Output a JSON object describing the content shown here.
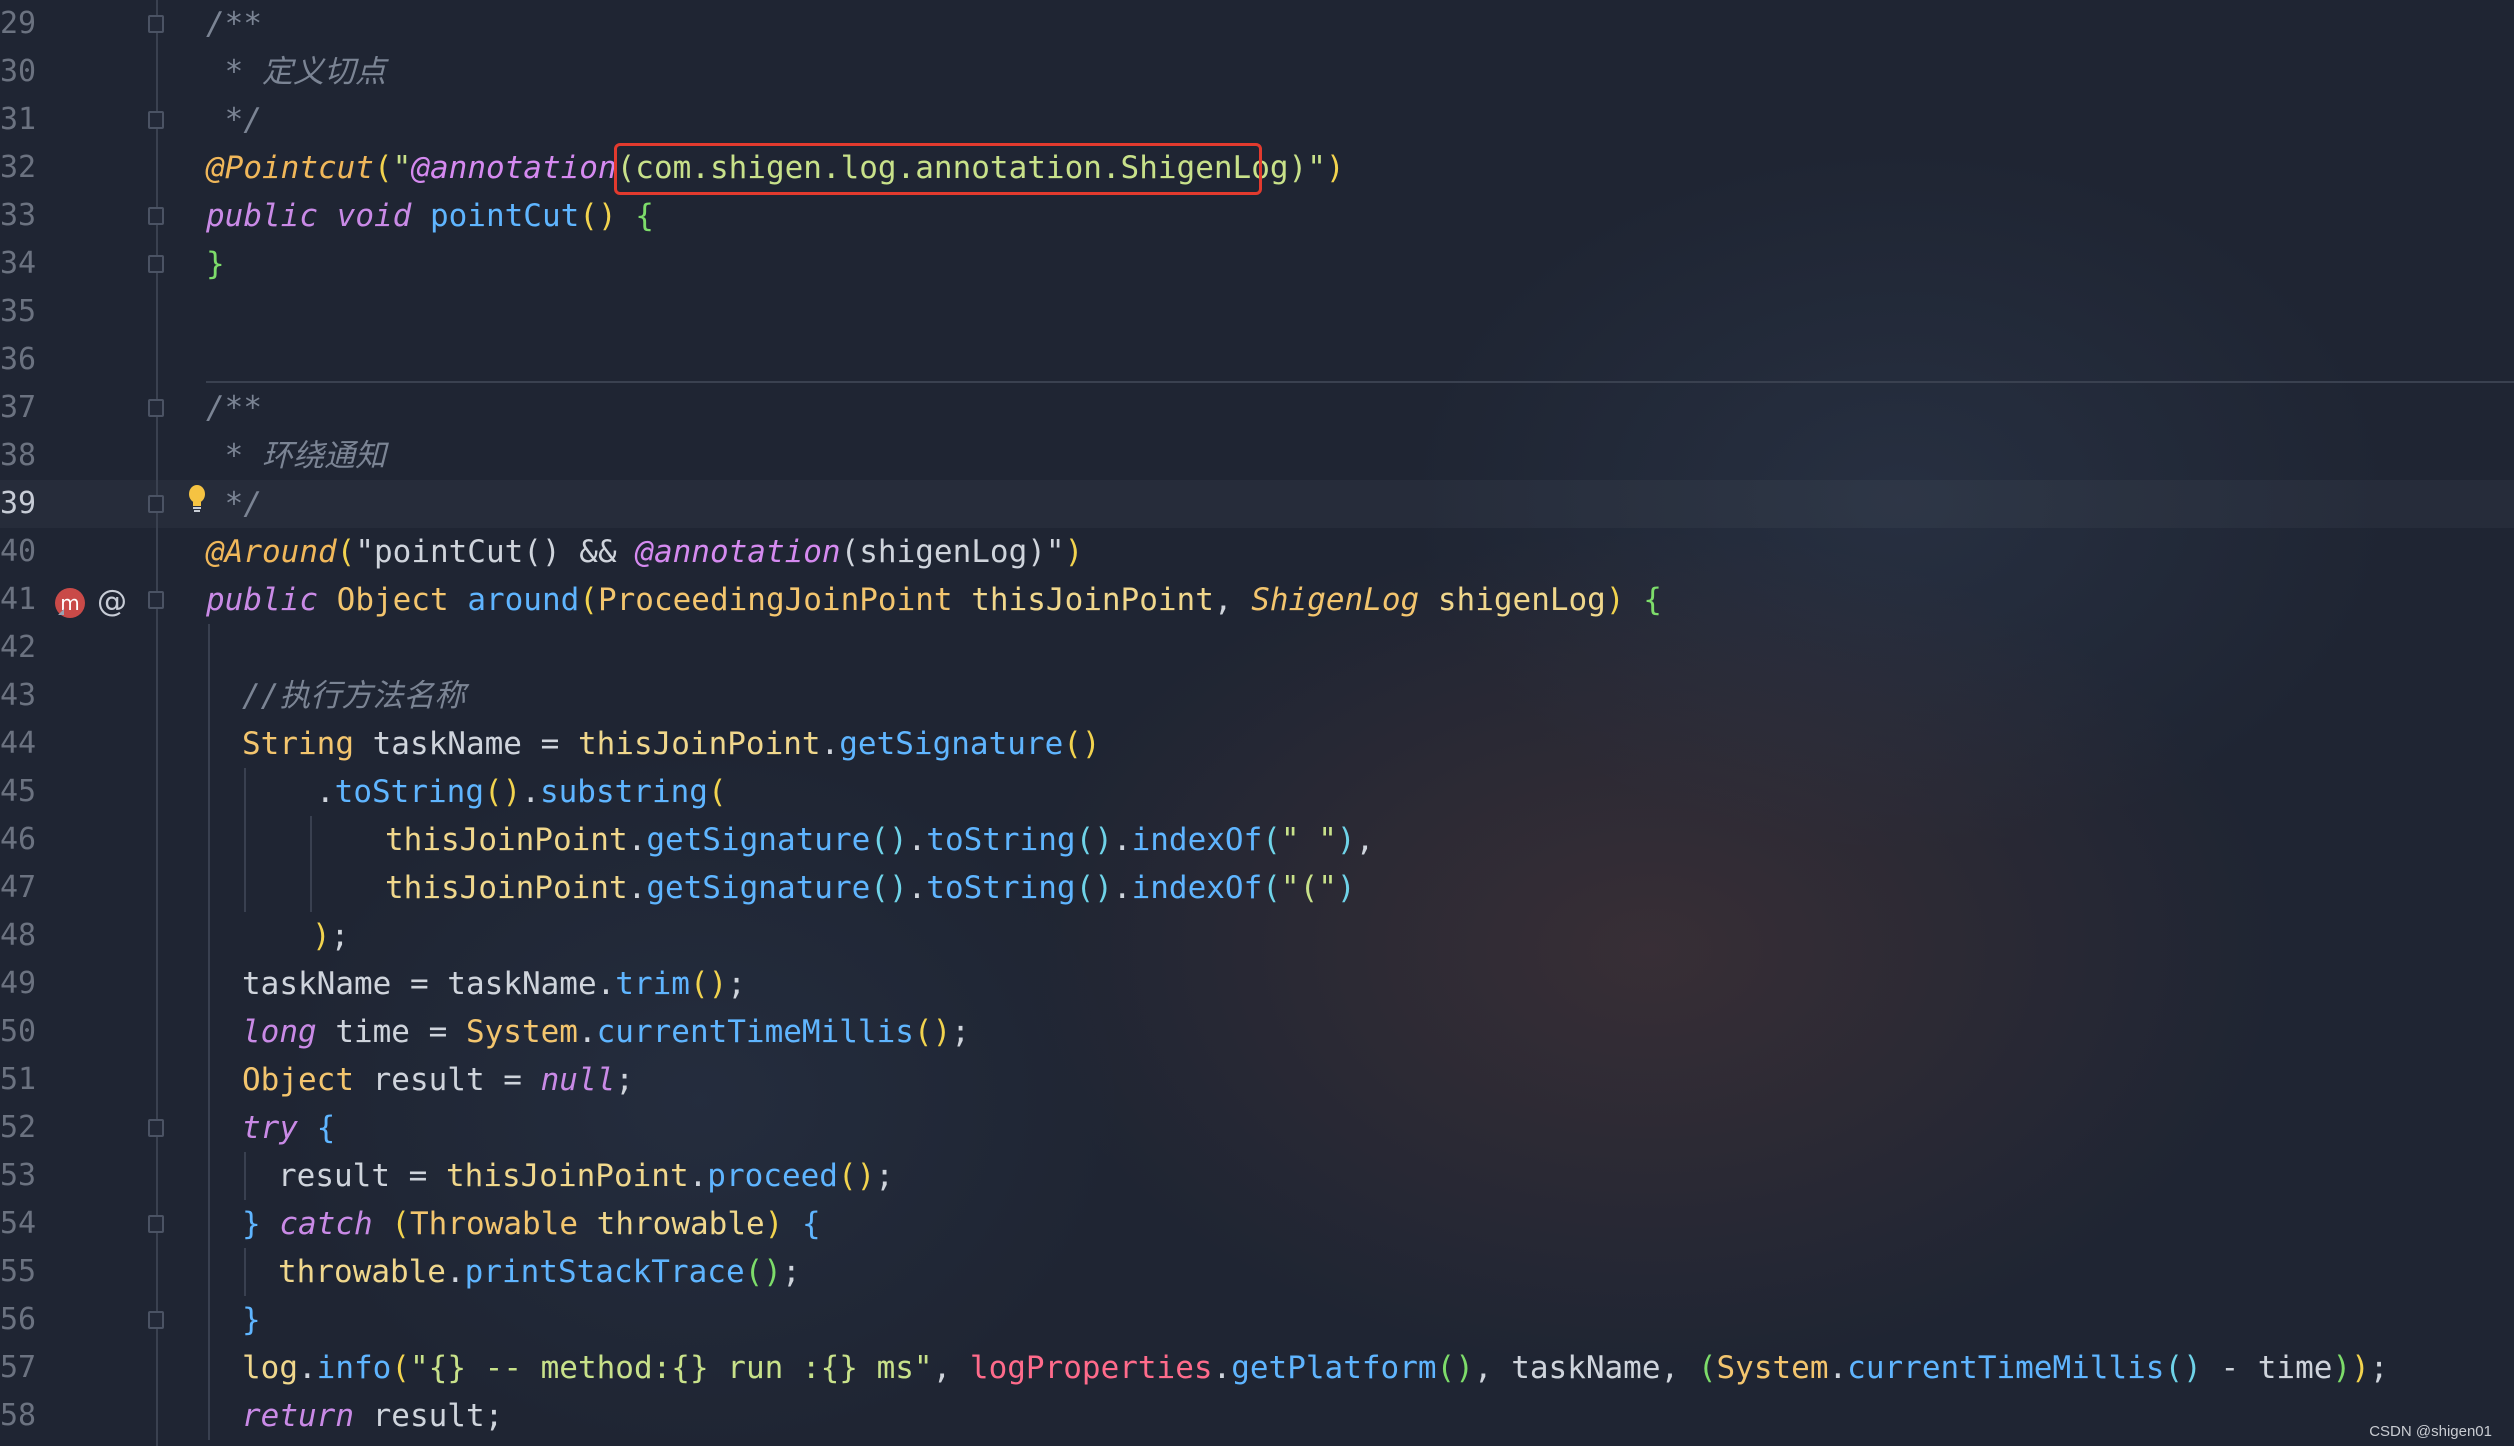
{
  "editor": {
    "current_line": "39",
    "line_numbers": [
      "29",
      "30",
      "31",
      "32",
      "33",
      "34",
      "35",
      "36",
      "37",
      "38",
      "39",
      "40",
      "41",
      "42",
      "43",
      "44",
      "45",
      "46",
      "47",
      "48",
      "49",
      "50",
      "51",
      "52",
      "53",
      "54",
      "55",
      "56",
      "57",
      "58"
    ],
    "code": {
      "l29_c": "/**",
      "l30_c": " * 定义切点",
      "l31_c": " */",
      "l32_ann": "@Pointcut",
      "l32_p1": "(",
      "l32_s1": "\"",
      "l32_s2": "@annotation",
      "l32_s3": "(com.shigen.log.annotation.ShigenLog)\"",
      "l32_p2": ")",
      "l33_k1": "public",
      "l33_k2": "void",
      "l33_m": "pointCut",
      "l33_p": "()",
      "l33_b": "{",
      "l34_b": "}",
      "l37_c": "/**",
      "l38_c": " * 环绕通知",
      "l39_c": " */",
      "l40_ann": "@Around",
      "l40_p1": "(",
      "l40_s1": "\"pointCut() && ",
      "l40_s2": "@annotation",
      "l40_s3": "(shigenLog)\"",
      "l40_p2": ")",
      "l41_k": "public",
      "l41_t": "Object",
      "l41_m": "around",
      "l41_p1": "(",
      "l41_t2": "ProceedingJoinPoint",
      "l41_v1": "thisJoinPoint",
      "l41_sep": ", ",
      "l41_t3": "ShigenLog",
      "l41_v2": "shigenLog",
      "l41_p2": ")",
      "l41_b": "{",
      "l43_c": "//执行方法名称",
      "l44_t": "String",
      "l44_a": " taskName = ",
      "l44_v": "thisJoinPoint",
      "l44_d": ".",
      "l44_m": "getSignature",
      "l44_p": "()",
      "l45_d": ".",
      "l45_m1": "toString",
      "l45_p1": "()",
      "l45_d2": ".",
      "l45_m2": "substring",
      "l45_p2": "(",
      "l46_v": "thisJoinPoint",
      "l46_d": ".",
      "l46_m1": "getSignature",
      "l46_p1": "()",
      "l46_d2": ".",
      "l46_m2": "toString",
      "l46_p2": "()",
      "l46_d3": ".",
      "l46_m3": "indexOf",
      "l46_p3": "(",
      "l46_s": "\" \"",
      "l46_p4": ")",
      "l46_e": ",",
      "l47_v": "thisJoinPoint",
      "l47_d": ".",
      "l47_m1": "getSignature",
      "l47_p1": "()",
      "l47_d2": ".",
      "l47_m2": "toString",
      "l47_p2": "()",
      "l47_d3": ".",
      "l47_m3": "indexOf",
      "l47_p3": "(",
      "l47_s": "\"(\"",
      "l47_p4": ")",
      "l48_p": ")",
      "l48_e": ";",
      "l49_a": "taskName = taskName",
      "l49_d": ".",
      "l49_m": "trim",
      "l49_p": "()",
      "l49_e": ";",
      "l50_k": "long",
      "l50_a": " time = ",
      "l50_c": "System",
      "l50_d": ".",
      "l50_m": "currentTimeMillis",
      "l50_p": "()",
      "l50_e": ";",
      "l51_t": "Object",
      "l51_a": " result = ",
      "l51_k": "null",
      "l51_e": ";",
      "l52_k": "try",
      "l52_b": "{",
      "l53_a": "result = ",
      "l53_v": "thisJoinPoint",
      "l53_d": ".",
      "l53_m": "proceed",
      "l53_p": "()",
      "l53_e": ";",
      "l54_b1": "}",
      "l54_k": "catch",
      "l54_p1": "(",
      "l54_t": "Throwable",
      "l54_v": "throwable",
      "l54_p2": ")",
      "l54_b2": "{",
      "l55_v": "throwable",
      "l55_d": ".",
      "l55_m": "printStackTrace",
      "l55_p": "()",
      "l55_e": ";",
      "l56_b": "}",
      "l57_v": "log",
      "l57_d": ".",
      "l57_m": "info",
      "l57_p1": "(",
      "l57_s": "\"{} -- method:{} run :{} ms\"",
      "l57_c1": ", ",
      "l57_f": "logProperties",
      "l57_d2": ".",
      "l57_m2": "getPlatform",
      "l57_p2": "()",
      "l57_c2": ", taskName, ",
      "l57_p3": "(",
      "l57_cls": "System",
      "l57_d3": ".",
      "l57_m3": "currentTimeMillis",
      "l57_p4": "()",
      "l57_a": " - time",
      "l57_p5": ")",
      "l57_p6": ")",
      "l57_e": ";",
      "l58_k": "return",
      "l58_a": " result;"
    }
  },
  "gutter_icons": {
    "override_icon_label": "m",
    "at_icon": "@",
    "bulb_icon": "lightbulb-icon"
  },
  "watermark": "CSDN @shigen01",
  "colors": {
    "highlight_box": "#e23a2e",
    "keyword": "#c98ae6",
    "annotation": "#f0b75a",
    "string": "#c8e18a",
    "method": "#5fb5ff",
    "comment": "#7b8494"
  }
}
